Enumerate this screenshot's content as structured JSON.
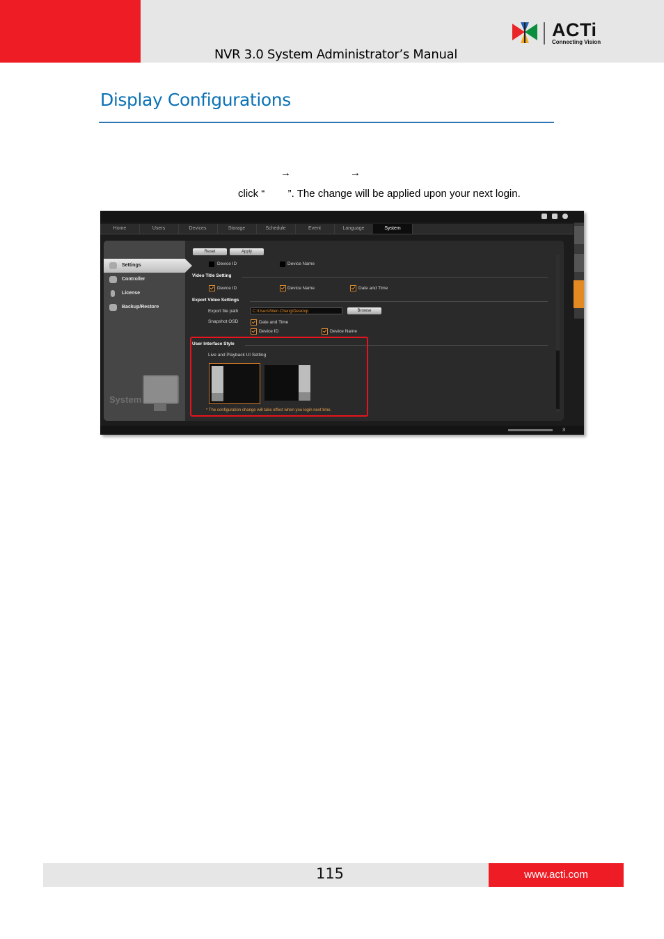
{
  "header": {
    "manual_title": "NVR 3.0 System Administrator’s Manual",
    "logo_text": "ACTi",
    "logo_tagline": "Connecting Vision"
  },
  "section": {
    "heading": "Display Configurations",
    "arrow_glyph": "→",
    "instruction_text": "click “        ”. The change will be applied upon your next login."
  },
  "screenshot": {
    "tabs": [
      "Home",
      "Users",
      "Devices",
      "Storage",
      "Schedule",
      "Event",
      "Language",
      "System"
    ],
    "active_tab": "System",
    "sidebar": {
      "items": [
        "Settings",
        "Controller",
        "License",
        "Backup/Restore"
      ],
      "active_item": "Settings",
      "title": "System"
    },
    "buttons": {
      "reset": "Reset",
      "apply": "Apply",
      "browse": "Browse"
    },
    "top_checks": {
      "device_id": "Device ID",
      "device_name": "Device Name"
    },
    "video_title": {
      "heading": "Video Title Setting",
      "device_id": "Device ID",
      "device_name": "Device Name",
      "date_time": "Date and Time"
    },
    "export": {
      "heading": "Export Video Settings",
      "path_label": "Export file path",
      "path_value": "C:\\Users\\Wen.Cheng\\Desktop",
      "osd_label": "Snapshot OSD",
      "osd_date_time": "Date and Time",
      "osd_device_id": "Device ID",
      "osd_device_name": "Device Name"
    },
    "ui_style": {
      "heading": "User Interface Style",
      "sub_label": "Live and Playback UI Setting",
      "note": "* The configuration change will take effect when you login next time."
    },
    "status_count": "3"
  },
  "footer": {
    "page_number": "115",
    "website": "www.acti.com"
  },
  "colors": {
    "brand_red": "#ee1c24",
    "heading_blue": "#0b72b5",
    "highlight_red": "#e8131d",
    "accent_orange": "#e48a22"
  }
}
